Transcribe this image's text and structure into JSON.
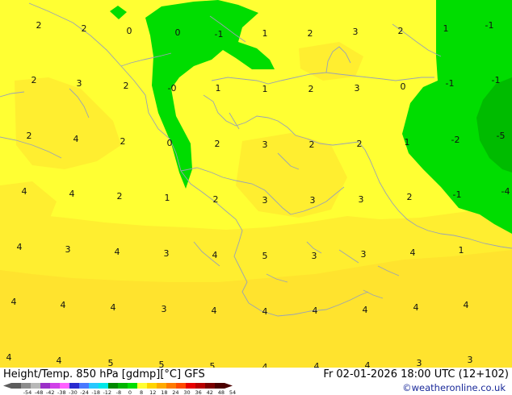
{
  "map": {
    "colors": {
      "yellow_bright": "#ffff33",
      "yellow_mid": "#ffee30",
      "yellow_dark": "#ffe32e",
      "green": "#00dd00",
      "green_dark": "#00bb00",
      "coast": "#9aa3b3"
    },
    "values": [
      "2",
      "2",
      "0",
      "0",
      "-1",
      "1",
      "2",
      "3",
      "2",
      "1",
      "-1",
      "2",
      "3",
      "2",
      "-0",
      "1",
      "1",
      "2",
      "3",
      "0",
      "-1",
      "-1",
      "2",
      "4",
      "2",
      "0",
      "2",
      "3",
      "2",
      "2",
      "1",
      "-2",
      "-5",
      "4",
      "4",
      "2",
      "1",
      "2",
      "3",
      "3",
      "3",
      "2",
      "-1",
      "-4",
      "4",
      "3",
      "4",
      "3",
      "4",
      "5",
      "3",
      "3",
      "4",
      "1",
      "4",
      "4",
      "4",
      "3",
      "4",
      "4",
      "4",
      "4",
      "4",
      "4",
      "4",
      "4",
      "5",
      "5",
      "5",
      "4",
      "4",
      "4",
      "3",
      "3"
    ]
  },
  "footer": {
    "title_left": "Height/Temp. 850 hPa [gdmp][°C] GFS",
    "title_right": "Fr 02-01-2026 18:00 UTC (12+102)",
    "credit": "©weatheronline.co.uk",
    "colorbar_ticks": [
      "-54",
      "-48",
      "-42",
      "-38",
      "-30",
      "-24",
      "-18",
      "-12",
      "-8",
      "0",
      "8",
      "12",
      "18",
      "24",
      "30",
      "36",
      "42",
      "48",
      "54"
    ],
    "colorbar_colors": [
      "#5c5c5c",
      "#8c8c8c",
      "#b8b8b8",
      "#9b30c8",
      "#d040e8",
      "#ff60ff",
      "#2a2ad0",
      "#4878ff",
      "#28c8ff",
      "#00e8e8",
      "#008800",
      "#00b400",
      "#00dd00",
      "#ffff33",
      "#ffd400",
      "#ffaa00",
      "#ff7a00",
      "#ff4a00",
      "#e80000",
      "#b80000",
      "#7a0000",
      "#4a0000"
    ]
  }
}
